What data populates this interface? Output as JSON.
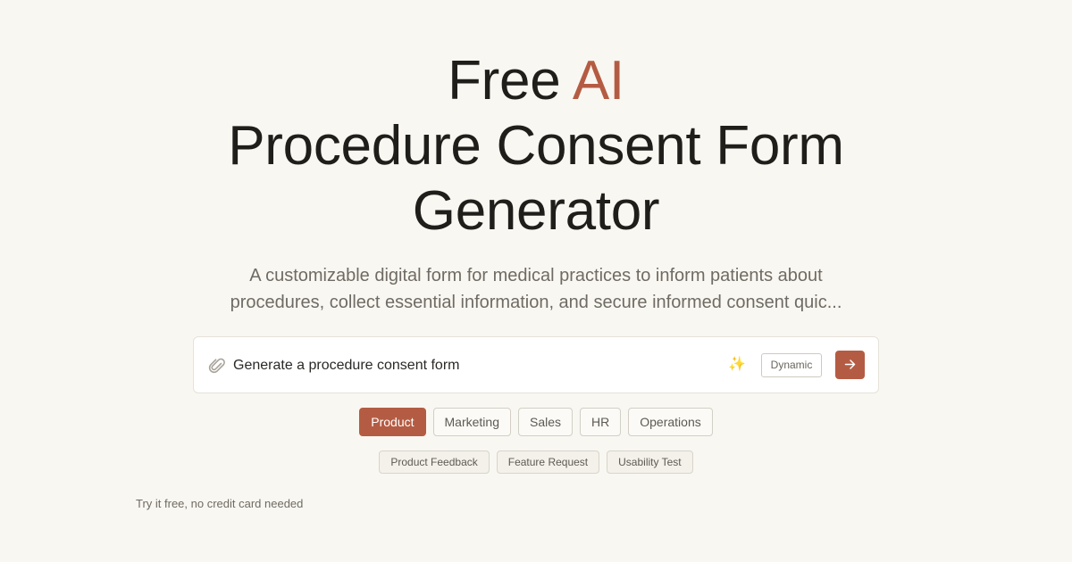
{
  "hero": {
    "title_line1_plain": "Free",
    "title_line1_accent": "AI",
    "title_line2": "Procedure Consent Form",
    "title_line3": "Generator",
    "subtitle": "A customizable digital form for medical practices to inform patients about procedures, collect essential information, and secure informed consent quic..."
  },
  "prompt": {
    "text": "Generate a procedure consent form",
    "attach_icon": "paperclip-icon",
    "sparkle_icon": "sparkle-icon",
    "mode_label": "Dynamic",
    "send_icon": "arrow-right-icon"
  },
  "categories": [
    {
      "label": "Product",
      "active": true
    },
    {
      "label": "Marketing",
      "active": false
    },
    {
      "label": "Sales",
      "active": false
    },
    {
      "label": "HR",
      "active": false
    },
    {
      "label": "Operations",
      "active": false
    }
  ],
  "templates": [
    {
      "label": "Product Feedback"
    },
    {
      "label": "Feature Request"
    },
    {
      "label": "Usability Test"
    }
  ],
  "footnote": "Try it free, no credit card needed",
  "colors": {
    "accent": "#b45c43",
    "background": "#f9f7f1",
    "text": "#1f1e1b"
  }
}
